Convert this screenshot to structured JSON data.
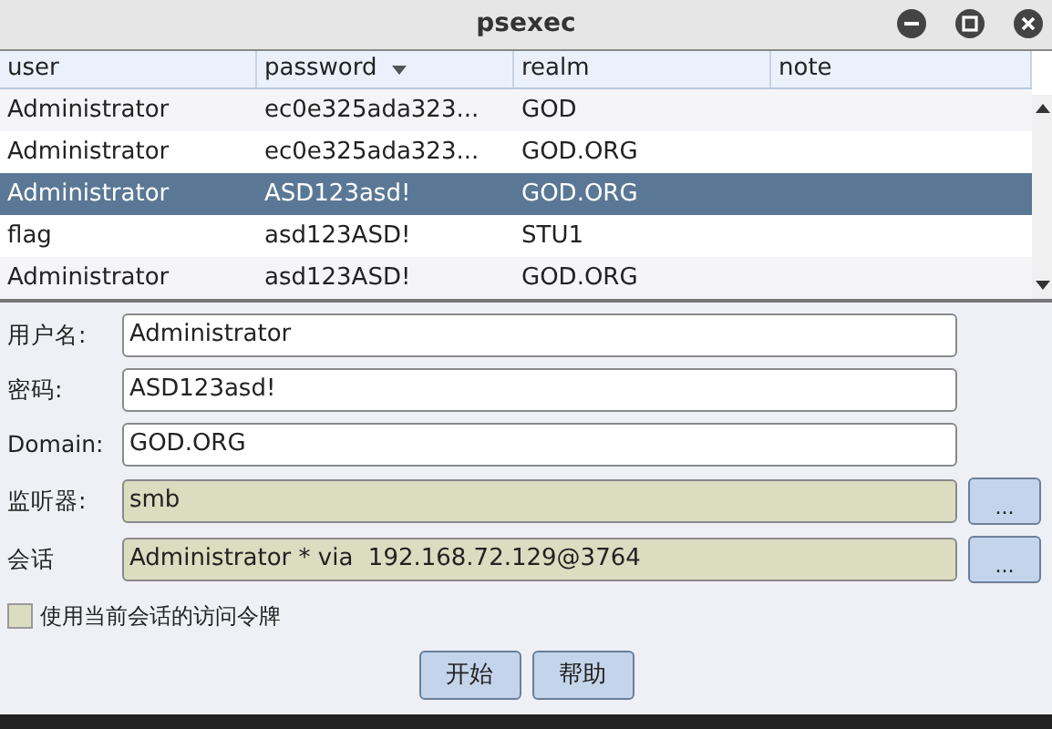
{
  "window": {
    "title": "psexec"
  },
  "table": {
    "columns": [
      {
        "label": "user",
        "sorted": false
      },
      {
        "label": "password",
        "sorted": true
      },
      {
        "label": "realm",
        "sorted": false
      },
      {
        "label": "note",
        "sorted": false
      }
    ],
    "rows": [
      {
        "cells": [
          "Administrator",
          "ec0e325ada323...",
          "GOD"
        ],
        "selected": false
      },
      {
        "cells": [
          "Administrator",
          "ec0e325ada323...",
          "GOD.ORG"
        ],
        "selected": false
      },
      {
        "cells": [
          "Administrator",
          "ASD123asd!",
          "GOD.ORG"
        ],
        "selected": true
      },
      {
        "cells": [
          "flag",
          "asd123ASD!",
          "STU1"
        ],
        "selected": false
      },
      {
        "cells": [
          "Administrator",
          "asd123ASD!",
          "GOD.ORG"
        ],
        "selected": false
      }
    ]
  },
  "form": {
    "fields": [
      {
        "label": "用户名:",
        "value": "Administrator",
        "editable": true
      },
      {
        "label": "密码:",
        "value": "ASD123asd!",
        "editable": true
      },
      {
        "label": "Domain:",
        "value": "GOD.ORG",
        "editable": true
      },
      {
        "label": "监听器:",
        "value": "smb",
        "editable": false,
        "button": "..."
      },
      {
        "label": "会话",
        "value": "Administrator * via  192.168.72.129@3764",
        "editable": false,
        "button": "..."
      }
    ],
    "checkbox": {
      "label": "使用当前会话的访问令牌",
      "checked": false
    },
    "buttons": [
      "开始",
      "帮助"
    ]
  }
}
